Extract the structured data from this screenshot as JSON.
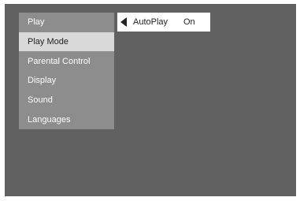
{
  "menu": {
    "items": [
      {
        "label": "Play",
        "selected": false
      },
      {
        "label": "Play Mode",
        "selected": true
      },
      {
        "label": "Parental Control",
        "selected": false
      },
      {
        "label": "Display",
        "selected": false
      },
      {
        "label": "Sound",
        "selected": false
      },
      {
        "label": "Languages",
        "selected": false
      }
    ]
  },
  "submenu": {
    "arrow_icon": "triangle-left-icon",
    "option_label": "AutoPlay",
    "option_value": "On"
  },
  "colors": {
    "screen_background": "#616161",
    "menu_background": "#8d8d8d",
    "selected_item_background": "#d9d9d9",
    "submenu_background": "#ffffff"
  }
}
